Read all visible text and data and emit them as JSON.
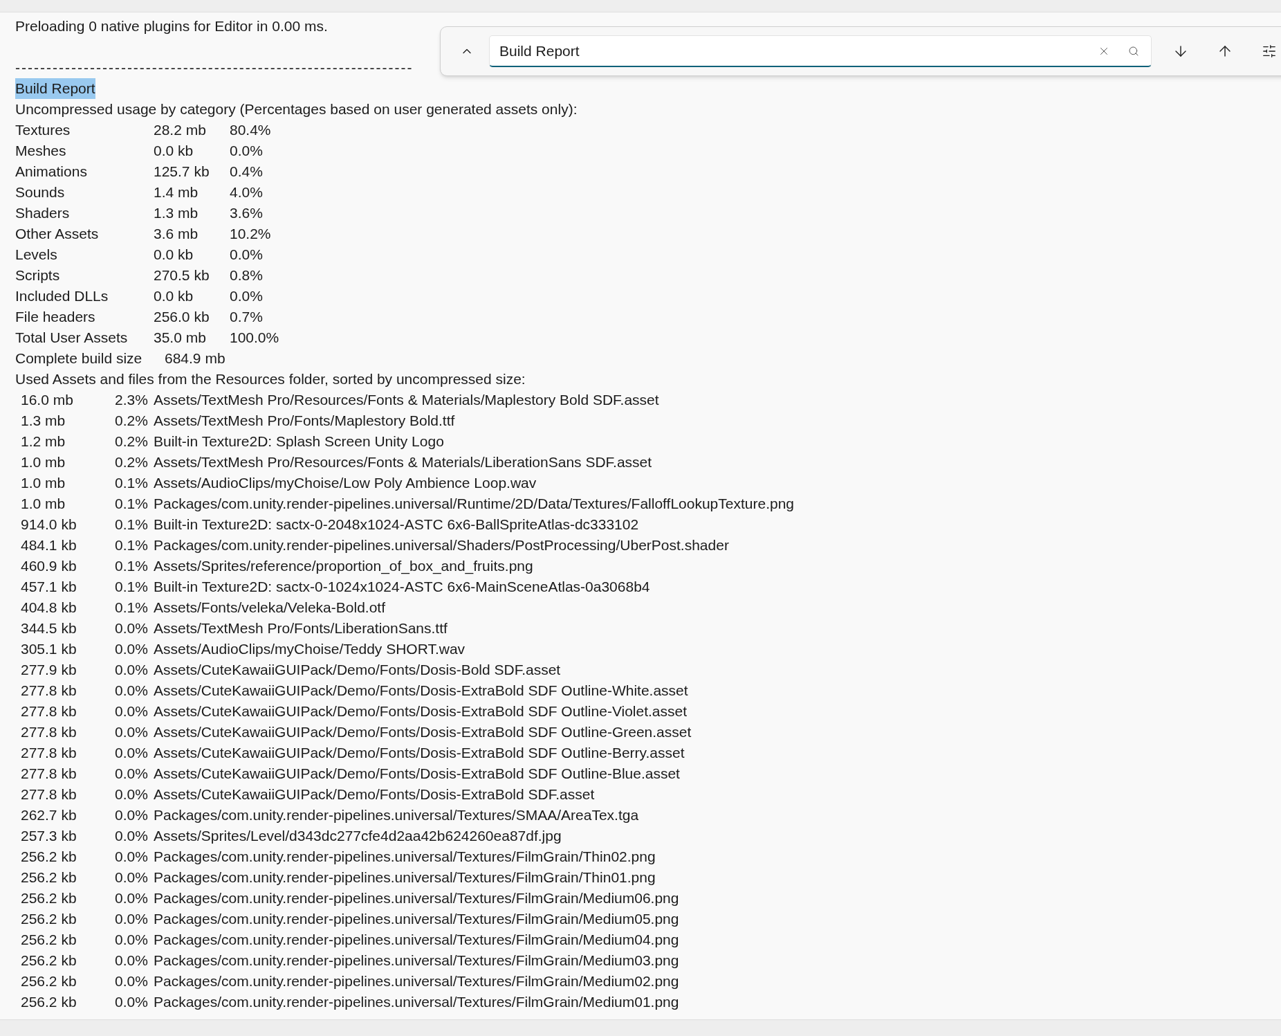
{
  "log_lines": [
    "Preloading 0 native plugins for Editor in 0.00 ms."
  ],
  "separator": "----------------------------------------------------------------",
  "report_title": {
    "text": "Build Report",
    "search_match": true
  },
  "category_heading": "Uncompressed usage by category (Percentages based on user generated assets only):",
  "categories": [
    {
      "name": "Textures",
      "size": "28.2 mb",
      "percent": "80.4%"
    },
    {
      "name": "Meshes",
      "size": "0.0 kb",
      "percent": "0.0%"
    },
    {
      "name": "Animations",
      "size": "125.7 kb",
      "percent": "0.4%"
    },
    {
      "name": "Sounds",
      "size": "1.4 mb",
      "percent": "4.0%"
    },
    {
      "name": "Shaders",
      "size": "1.3 mb",
      "percent": "3.6%"
    },
    {
      "name": "Other Assets",
      "size": "3.6 mb",
      "percent": "10.2%"
    },
    {
      "name": "Levels",
      "size": "0.0 kb",
      "percent": "0.0%"
    },
    {
      "name": "Scripts",
      "size": "270.5 kb",
      "percent": "0.8%"
    },
    {
      "name": "Included DLLs",
      "size": "0.0 kb",
      "percent": "0.0%"
    },
    {
      "name": "File headers",
      "size": "256.0 kb",
      "percent": "0.7%"
    },
    {
      "name": "Total User Assets",
      "size": "35.0 mb",
      "percent": "100.0%"
    }
  ],
  "complete_build": {
    "label": "Complete build size",
    "size": "684.9 mb"
  },
  "assets_heading": "Used Assets and files from the Resources folder, sorted by uncompressed size:",
  "assets": [
    {
      "size": "16.0 mb",
      "percent": "2.3%",
      "path": "Assets/TextMesh Pro/Resources/Fonts & Materials/Maplestory Bold SDF.asset"
    },
    {
      "size": "1.3 mb",
      "percent": "0.2%",
      "path": "Assets/TextMesh Pro/Fonts/Maplestory Bold.ttf"
    },
    {
      "size": "1.2 mb",
      "percent": "0.2%",
      "path": "Built-in Texture2D: Splash Screen Unity Logo"
    },
    {
      "size": "1.0 mb",
      "percent": "0.2%",
      "path": "Assets/TextMesh Pro/Resources/Fonts & Materials/LiberationSans SDF.asset"
    },
    {
      "size": "1.0 mb",
      "percent": "0.1%",
      "path": "Assets/AudioClips/myChoise/Low Poly Ambience Loop.wav"
    },
    {
      "size": "1.0 mb",
      "percent": "0.1%",
      "path": "Packages/com.unity.render-pipelines.universal/Runtime/2D/Data/Textures/FalloffLookupTexture.png"
    },
    {
      "size": "914.0 kb",
      "percent": "0.1%",
      "path": "Built-in Texture2D: sactx-0-2048x1024-ASTC 6x6-BallSpriteAtlas-dc333102"
    },
    {
      "size": "484.1 kb",
      "percent": "0.1%",
      "path": "Packages/com.unity.render-pipelines.universal/Shaders/PostProcessing/UberPost.shader"
    },
    {
      "size": "460.9 kb",
      "percent": "0.1%",
      "path": "Assets/Sprites/reference/proportion_of_box_and_fruits.png"
    },
    {
      "size": "457.1 kb",
      "percent": "0.1%",
      "path": "Built-in Texture2D: sactx-0-1024x1024-ASTC 6x6-MainSceneAtlas-0a3068b4"
    },
    {
      "size": "404.8 kb",
      "percent": "0.1%",
      "path": "Assets/Fonts/veleka/Veleka-Bold.otf"
    },
    {
      "size": "344.5 kb",
      "percent": "0.0%",
      "path": "Assets/TextMesh Pro/Fonts/LiberationSans.ttf"
    },
    {
      "size": "305.1 kb",
      "percent": "0.0%",
      "path": "Assets/AudioClips/myChoise/Teddy SHORT.wav"
    },
    {
      "size": "277.9 kb",
      "percent": "0.0%",
      "path": "Assets/CuteKawaiiGUIPack/Demo/Fonts/Dosis-Bold SDF.asset"
    },
    {
      "size": "277.8 kb",
      "percent": "0.0%",
      "path": "Assets/CuteKawaiiGUIPack/Demo/Fonts/Dosis-ExtraBold SDF Outline-White.asset"
    },
    {
      "size": "277.8 kb",
      "percent": "0.0%",
      "path": "Assets/CuteKawaiiGUIPack/Demo/Fonts/Dosis-ExtraBold SDF Outline-Violet.asset"
    },
    {
      "size": "277.8 kb",
      "percent": "0.0%",
      "path": "Assets/CuteKawaiiGUIPack/Demo/Fonts/Dosis-ExtraBold SDF Outline-Green.asset"
    },
    {
      "size": "277.8 kb",
      "percent": "0.0%",
      "path": "Assets/CuteKawaiiGUIPack/Demo/Fonts/Dosis-ExtraBold SDF Outline-Berry.asset"
    },
    {
      "size": "277.8 kb",
      "percent": "0.0%",
      "path": "Assets/CuteKawaiiGUIPack/Demo/Fonts/Dosis-ExtraBold SDF Outline-Blue.asset"
    },
    {
      "size": "277.8 kb",
      "percent": "0.0%",
      "path": "Assets/CuteKawaiiGUIPack/Demo/Fonts/Dosis-ExtraBold SDF.asset"
    },
    {
      "size": "262.7 kb",
      "percent": "0.0%",
      "path": "Packages/com.unity.render-pipelines.universal/Textures/SMAA/AreaTex.tga"
    },
    {
      "size": "257.3 kb",
      "percent": "0.0%",
      "path": "Assets/Sprites/Level/d343dc277cfe4d2aa42b624260ea87df.jpg"
    },
    {
      "size": "256.2 kb",
      "percent": "0.0%",
      "path": "Packages/com.unity.render-pipelines.universal/Textures/FilmGrain/Thin02.png"
    },
    {
      "size": "256.2 kb",
      "percent": "0.0%",
      "path": "Packages/com.unity.render-pipelines.universal/Textures/FilmGrain/Thin01.png"
    },
    {
      "size": "256.2 kb",
      "percent": "0.0%",
      "path": "Packages/com.unity.render-pipelines.universal/Textures/FilmGrain/Medium06.png"
    },
    {
      "size": "256.2 kb",
      "percent": "0.0%",
      "path": "Packages/com.unity.render-pipelines.universal/Textures/FilmGrain/Medium05.png"
    },
    {
      "size": "256.2 kb",
      "percent": "0.0%",
      "path": "Packages/com.unity.render-pipelines.universal/Textures/FilmGrain/Medium04.png"
    },
    {
      "size": "256.2 kb",
      "percent": "0.0%",
      "path": "Packages/com.unity.render-pipelines.universal/Textures/FilmGrain/Medium03.png"
    },
    {
      "size": "256.2 kb",
      "percent": "0.0%",
      "path": "Packages/com.unity.render-pipelines.universal/Textures/FilmGrain/Medium02.png"
    },
    {
      "size": "256.2 kb",
      "percent": "0.0%",
      "path": "Packages/com.unity.render-pipelines.universal/Textures/FilmGrain/Medium01.png"
    }
  ],
  "find_bar": {
    "query": "Build Report"
  }
}
